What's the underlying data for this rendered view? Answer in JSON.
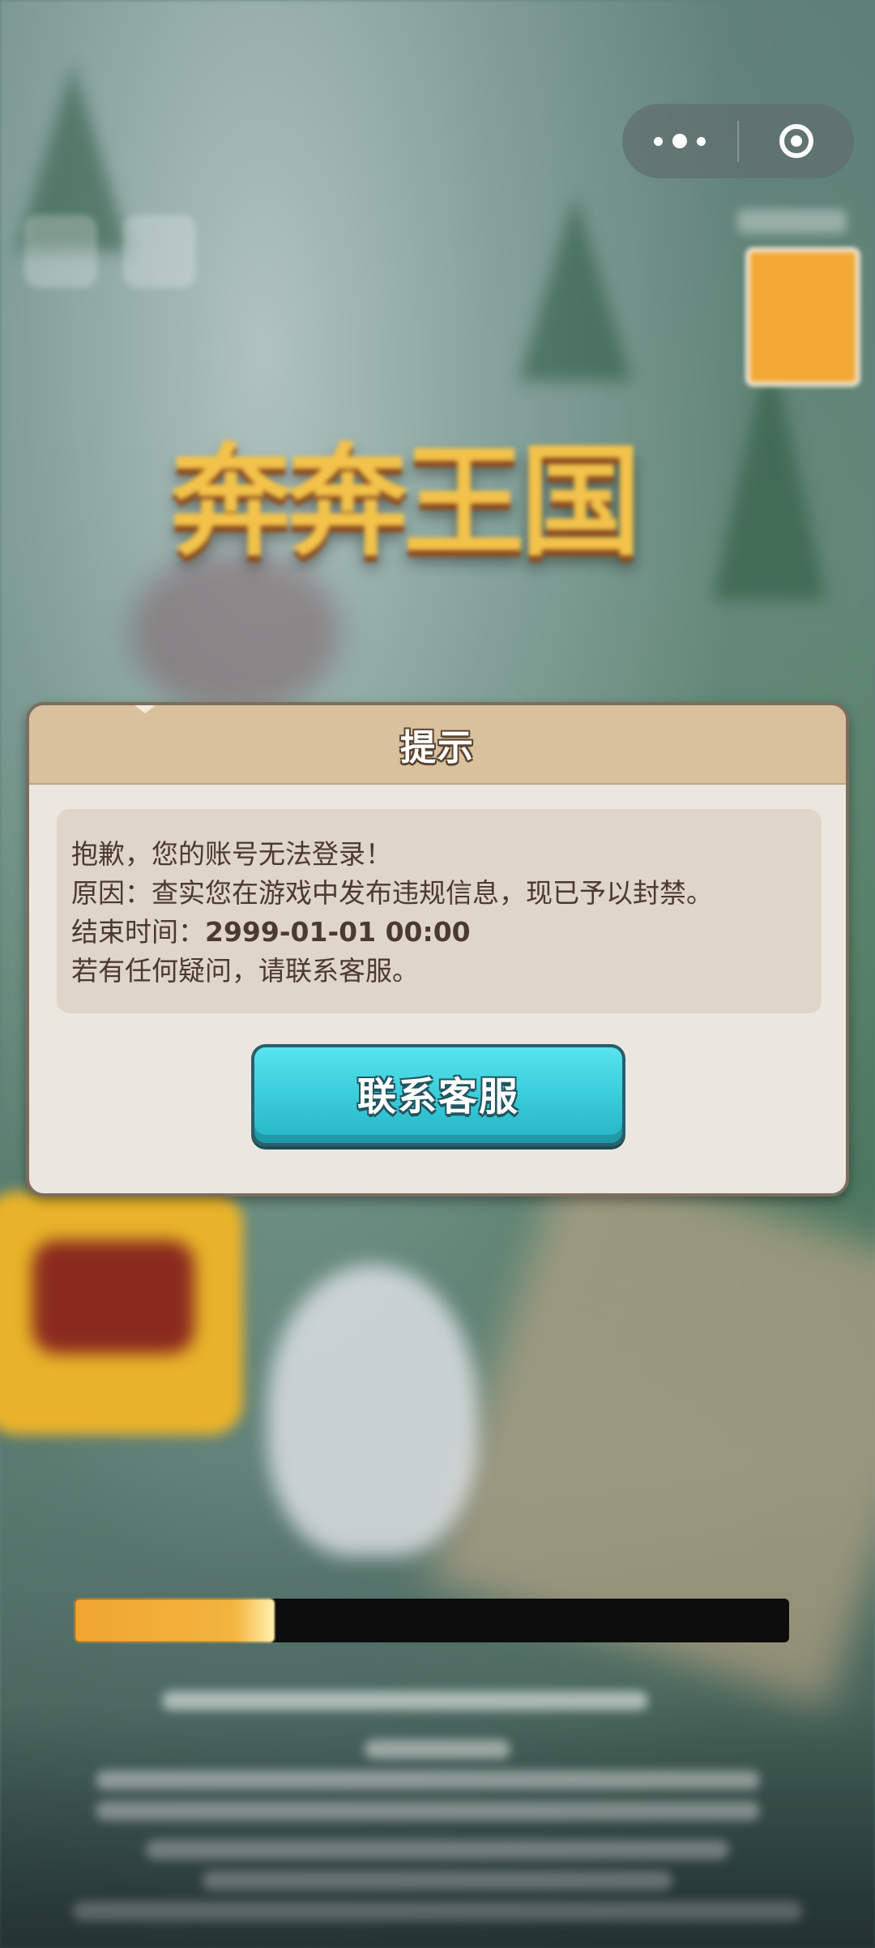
{
  "capsule": {
    "more_icon": "more-dots-icon",
    "close_icon": "close-target-icon"
  },
  "game": {
    "logo_text": "奔奔王国"
  },
  "dialog": {
    "title": "提示",
    "message": {
      "line1": "抱歉，您的账号无法登录！",
      "line2": "原因：查实您在游戏中发布违规信息，现已予以封禁。",
      "line3_label": "结束时间：",
      "line3_value": "2999-01-01 00:00",
      "line4": "若有任何疑问，请联系客服。"
    },
    "button_label": "联系客服"
  },
  "loading": {
    "progress": 0.28
  },
  "colors": {
    "dialog_header": "#d8c19c",
    "dialog_body": "#ebe7e0",
    "message_box": "#dfd5c9",
    "button": "#3ccfdc",
    "progress_fill": "#f0a532"
  }
}
